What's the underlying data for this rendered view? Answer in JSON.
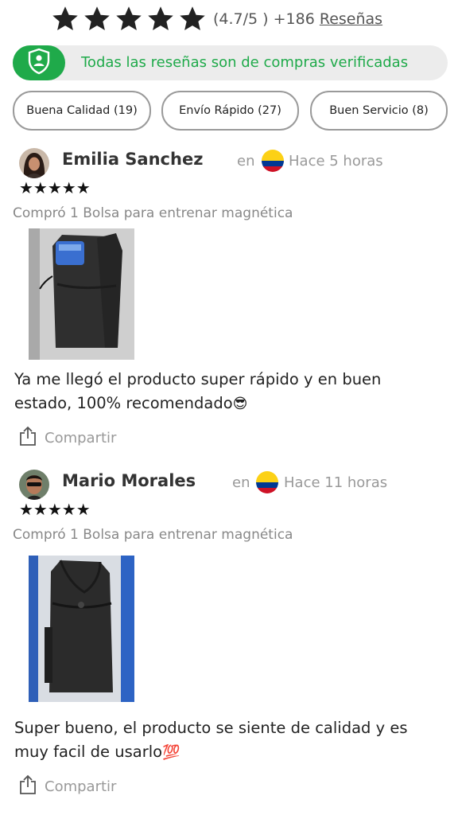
{
  "header": {
    "rating": "(4.7/5 )",
    "count": "+186",
    "reviews_link": "Reseñas",
    "star_icon": "star-icon"
  },
  "verified": {
    "text": "Todas las reseñas son de compras verificadas",
    "icon": "verified-shield-icon",
    "color": "#1faa4a"
  },
  "tags": [
    {
      "label": "Buena Calidad (19)"
    },
    {
      "label": "Envío Rápido (27)"
    },
    {
      "label": "Buen Servicio (8)"
    }
  ],
  "reviews": [
    {
      "name": "Emilia Sanchez",
      "en": "en",
      "time": "Hace 5 horas",
      "stars": "★★★★★",
      "bought": "Compró 1 Bolsa para entrenar magnética",
      "comment": "Ya me llegó el producto super rápido y en buen estado, 100% recomendado",
      "emoji": "😎",
      "share": "Compartir"
    },
    {
      "name": "Mario Morales",
      "en": "en",
      "time": "Hace 11 horas",
      "stars": "★★★★★",
      "bought": "Compró 1 Bolsa para entrenar magnética",
      "comment": "Super bueno, el producto se siente de calidad y es muy facil de usarlo",
      "emoji": "💯",
      "share": "Compartir"
    }
  ]
}
